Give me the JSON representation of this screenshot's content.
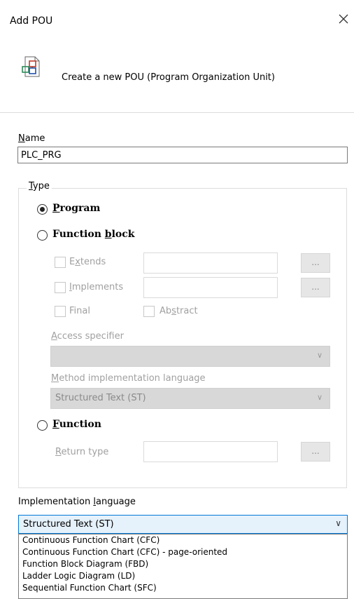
{
  "dialog": {
    "title": "Add POU"
  },
  "header": {
    "description": "Create a new POU (Program Organization Unit)"
  },
  "name": {
    "label_ul": "N",
    "label_rest": "ame",
    "value": "PLC_PRG"
  },
  "type": {
    "label_ul": "T",
    "label_rest": "ype",
    "program": {
      "label_ul": "P",
      "label_rest": "rogram",
      "selected": true
    },
    "function_block": {
      "label_pre": "Function ",
      "label_ul": "b",
      "label_rest": "lock",
      "extends": {
        "pre": "E",
        "ul": "x",
        "rest": "tends"
      },
      "implements": {
        "ul": "I",
        "rest": "mplements"
      },
      "browse_label": "...",
      "final_label": "Final",
      "abstract": {
        "pre": "Ab",
        "ul": "s",
        "rest": "tract"
      },
      "access_specifier": {
        "ul": "A",
        "rest": "ccess specifier"
      },
      "method_language": {
        "ul": "M",
        "rest": "ethod implementation language",
        "value": "Structured Text (ST)"
      }
    },
    "function": {
      "label_ul": "F",
      "label_rest": "unction",
      "return_type": {
        "ul": "R",
        "rest": "eturn type"
      }
    }
  },
  "implementation": {
    "label_pre": "Implementation ",
    "label_ul": "l",
    "label_rest": "anguage",
    "value": "Structured Text (ST)",
    "options": [
      "Continuous Function Chart (CFC)",
      "Continuous Function Chart (CFC) - page-oriented",
      "Function Block Diagram (FBD)",
      "Ladder Logic Diagram (LD)",
      "Sequential Function Chart (SFC)"
    ]
  }
}
